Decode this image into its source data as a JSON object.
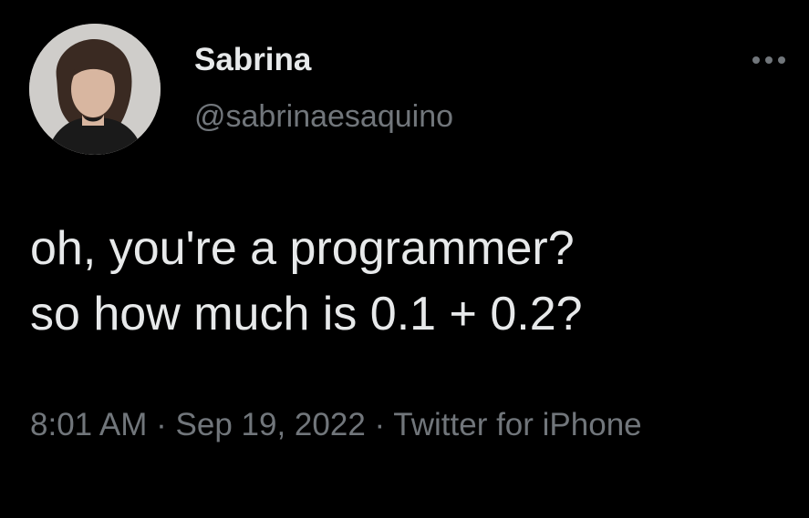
{
  "author": {
    "display_name": "Sabrina",
    "handle": "@sabrinaesaquino",
    "avatar": "user-avatar-photo"
  },
  "menu": {
    "icon": "more-options-icon"
  },
  "tweet": {
    "lines": [
      "oh, you're a programmer?",
      "so how much is 0.1 + 0.2?"
    ]
  },
  "meta": {
    "time": "8:01 AM",
    "separator": "·",
    "date": "Sep 19, 2022",
    "source": "Twitter for iPhone"
  },
  "colors": {
    "background": "#000000",
    "primary_text": "#e7e9ea",
    "secondary_text": "#71767b"
  }
}
